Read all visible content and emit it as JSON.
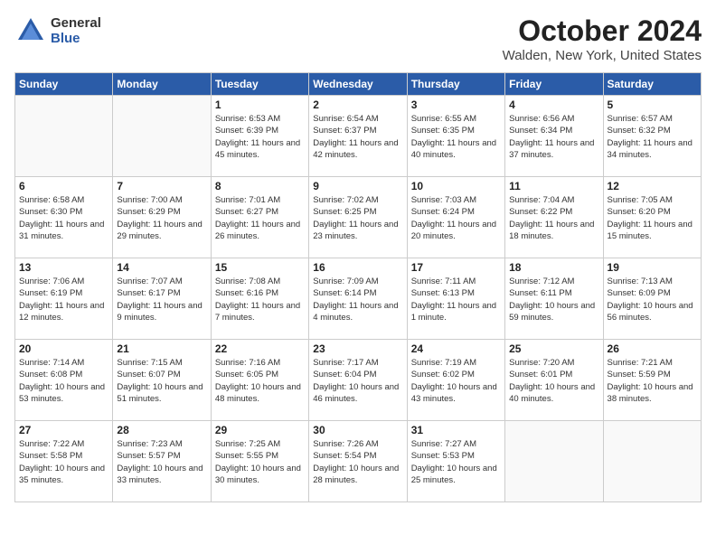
{
  "header": {
    "logo_general": "General",
    "logo_blue": "Blue",
    "month": "October 2024",
    "location": "Walden, New York, United States"
  },
  "days_of_week": [
    "Sunday",
    "Monday",
    "Tuesday",
    "Wednesday",
    "Thursday",
    "Friday",
    "Saturday"
  ],
  "weeks": [
    [
      {
        "num": "",
        "info": ""
      },
      {
        "num": "",
        "info": ""
      },
      {
        "num": "1",
        "info": "Sunrise: 6:53 AM\nSunset: 6:39 PM\nDaylight: 11 hours and 45 minutes."
      },
      {
        "num": "2",
        "info": "Sunrise: 6:54 AM\nSunset: 6:37 PM\nDaylight: 11 hours and 42 minutes."
      },
      {
        "num": "3",
        "info": "Sunrise: 6:55 AM\nSunset: 6:35 PM\nDaylight: 11 hours and 40 minutes."
      },
      {
        "num": "4",
        "info": "Sunrise: 6:56 AM\nSunset: 6:34 PM\nDaylight: 11 hours and 37 minutes."
      },
      {
        "num": "5",
        "info": "Sunrise: 6:57 AM\nSunset: 6:32 PM\nDaylight: 11 hours and 34 minutes."
      }
    ],
    [
      {
        "num": "6",
        "info": "Sunrise: 6:58 AM\nSunset: 6:30 PM\nDaylight: 11 hours and 31 minutes."
      },
      {
        "num": "7",
        "info": "Sunrise: 7:00 AM\nSunset: 6:29 PM\nDaylight: 11 hours and 29 minutes."
      },
      {
        "num": "8",
        "info": "Sunrise: 7:01 AM\nSunset: 6:27 PM\nDaylight: 11 hours and 26 minutes."
      },
      {
        "num": "9",
        "info": "Sunrise: 7:02 AM\nSunset: 6:25 PM\nDaylight: 11 hours and 23 minutes."
      },
      {
        "num": "10",
        "info": "Sunrise: 7:03 AM\nSunset: 6:24 PM\nDaylight: 11 hours and 20 minutes."
      },
      {
        "num": "11",
        "info": "Sunrise: 7:04 AM\nSunset: 6:22 PM\nDaylight: 11 hours and 18 minutes."
      },
      {
        "num": "12",
        "info": "Sunrise: 7:05 AM\nSunset: 6:20 PM\nDaylight: 11 hours and 15 minutes."
      }
    ],
    [
      {
        "num": "13",
        "info": "Sunrise: 7:06 AM\nSunset: 6:19 PM\nDaylight: 11 hours and 12 minutes."
      },
      {
        "num": "14",
        "info": "Sunrise: 7:07 AM\nSunset: 6:17 PM\nDaylight: 11 hours and 9 minutes."
      },
      {
        "num": "15",
        "info": "Sunrise: 7:08 AM\nSunset: 6:16 PM\nDaylight: 11 hours and 7 minutes."
      },
      {
        "num": "16",
        "info": "Sunrise: 7:09 AM\nSunset: 6:14 PM\nDaylight: 11 hours and 4 minutes."
      },
      {
        "num": "17",
        "info": "Sunrise: 7:11 AM\nSunset: 6:13 PM\nDaylight: 11 hours and 1 minute."
      },
      {
        "num": "18",
        "info": "Sunrise: 7:12 AM\nSunset: 6:11 PM\nDaylight: 10 hours and 59 minutes."
      },
      {
        "num": "19",
        "info": "Sunrise: 7:13 AM\nSunset: 6:09 PM\nDaylight: 10 hours and 56 minutes."
      }
    ],
    [
      {
        "num": "20",
        "info": "Sunrise: 7:14 AM\nSunset: 6:08 PM\nDaylight: 10 hours and 53 minutes."
      },
      {
        "num": "21",
        "info": "Sunrise: 7:15 AM\nSunset: 6:07 PM\nDaylight: 10 hours and 51 minutes."
      },
      {
        "num": "22",
        "info": "Sunrise: 7:16 AM\nSunset: 6:05 PM\nDaylight: 10 hours and 48 minutes."
      },
      {
        "num": "23",
        "info": "Sunrise: 7:17 AM\nSunset: 6:04 PM\nDaylight: 10 hours and 46 minutes."
      },
      {
        "num": "24",
        "info": "Sunrise: 7:19 AM\nSunset: 6:02 PM\nDaylight: 10 hours and 43 minutes."
      },
      {
        "num": "25",
        "info": "Sunrise: 7:20 AM\nSunset: 6:01 PM\nDaylight: 10 hours and 40 minutes."
      },
      {
        "num": "26",
        "info": "Sunrise: 7:21 AM\nSunset: 5:59 PM\nDaylight: 10 hours and 38 minutes."
      }
    ],
    [
      {
        "num": "27",
        "info": "Sunrise: 7:22 AM\nSunset: 5:58 PM\nDaylight: 10 hours and 35 minutes."
      },
      {
        "num": "28",
        "info": "Sunrise: 7:23 AM\nSunset: 5:57 PM\nDaylight: 10 hours and 33 minutes."
      },
      {
        "num": "29",
        "info": "Sunrise: 7:25 AM\nSunset: 5:55 PM\nDaylight: 10 hours and 30 minutes."
      },
      {
        "num": "30",
        "info": "Sunrise: 7:26 AM\nSunset: 5:54 PM\nDaylight: 10 hours and 28 minutes."
      },
      {
        "num": "31",
        "info": "Sunrise: 7:27 AM\nSunset: 5:53 PM\nDaylight: 10 hours and 25 minutes."
      },
      {
        "num": "",
        "info": ""
      },
      {
        "num": "",
        "info": ""
      }
    ]
  ]
}
